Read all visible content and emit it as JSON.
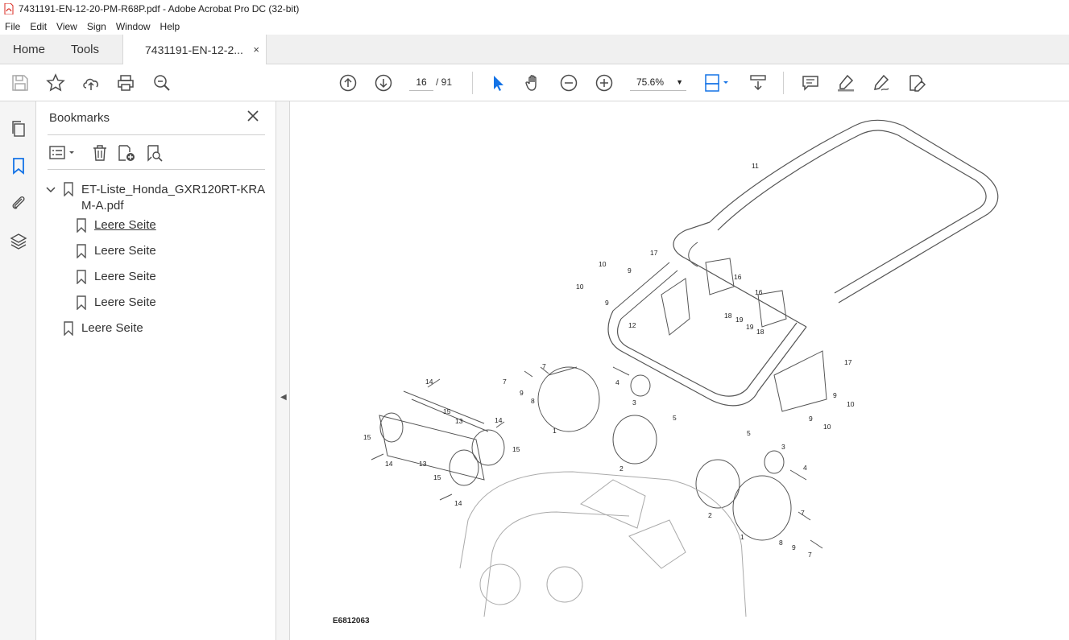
{
  "window": {
    "title": "7431191-EN-12-20-PM-R68P.pdf - Adobe Acrobat Pro DC (32-bit)"
  },
  "menu": [
    "File",
    "Edit",
    "View",
    "Sign",
    "Window",
    "Help"
  ],
  "tabs": {
    "home": "Home",
    "tools": "Tools",
    "document": "7431191-EN-12-2...",
    "close_symbol": "×"
  },
  "toolbar": {
    "current_page": "16",
    "page_separator": "/ 91",
    "zoom": "75.6%"
  },
  "bookmarks_panel": {
    "title": "Bookmarks",
    "root": "ET-Liste_Honda_GXR120RT-KRAM-A.pdf",
    "children": [
      "Leere Seite",
      "Leere Seite",
      "Leere Seite",
      "Leere Seite"
    ],
    "sibling": "Leere Seite"
  },
  "document": {
    "figure_code": "E6812063",
    "callouts": [
      "11",
      "10",
      "17",
      "9",
      "10",
      "9",
      "16",
      "16",
      "18",
      "19",
      "19",
      "18",
      "12",
      "7",
      "7",
      "9",
      "8",
      "4",
      "3",
      "5",
      "1",
      "2",
      "17",
      "9",
      "10",
      "9",
      "10",
      "14",
      "15",
      "13",
      "14",
      "15",
      "15",
      "14",
      "13",
      "15",
      "14",
      "5",
      "3",
      "4",
      "2",
      "1",
      "7",
      "8",
      "9",
      "7"
    ]
  },
  "colors": {
    "accent_blue": "#1473e6",
    "icon_gray": "#4b4b4b",
    "pdf_red": "#d9261c"
  }
}
